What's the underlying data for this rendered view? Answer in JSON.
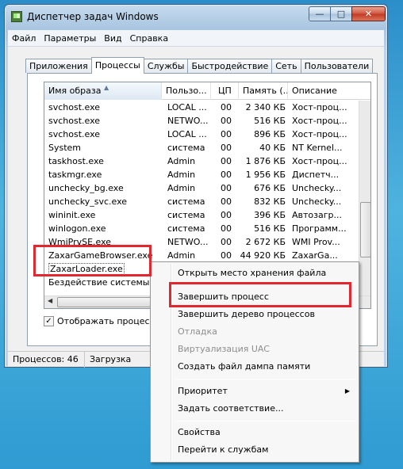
{
  "window": {
    "title": "Диспетчер задач Windows",
    "min_label": "—",
    "max_label": "□",
    "close_label": "✕"
  },
  "menu": [
    "Файл",
    "Параметры",
    "Вид",
    "Справка"
  ],
  "tabs": [
    "Приложения",
    "Процессы",
    "Службы",
    "Быстродействие",
    "Сеть",
    "Пользователи"
  ],
  "active_tab": "Процессы",
  "columns": [
    "Имя образа",
    "Пользо...",
    "ЦП",
    "Память (...",
    "Описание"
  ],
  "rows": [
    {
      "name": "svchost.exe",
      "user": "LOCAL ...",
      "cpu": "00",
      "mem": "2 340 КБ",
      "desc": "Хост-проц..."
    },
    {
      "name": "svchost.exe",
      "user": "NETWO...",
      "cpu": "00",
      "mem": "516 КБ",
      "desc": "Хост-проц..."
    },
    {
      "name": "svchost.exe",
      "user": "LOCAL ...",
      "cpu": "00",
      "mem": "896 КБ",
      "desc": "Хост-проц..."
    },
    {
      "name": "System",
      "user": "система",
      "cpu": "00",
      "mem": "40 КБ",
      "desc": "NT Kernel..."
    },
    {
      "name": "taskhost.exe",
      "user": "Admin",
      "cpu": "00",
      "mem": "1 876 КБ",
      "desc": "Хост-проц..."
    },
    {
      "name": "taskmgr.exe",
      "user": "Admin",
      "cpu": "00",
      "mem": "1 956 КБ",
      "desc": "Диспетч..."
    },
    {
      "name": "unchecky_bg.exe",
      "user": "Admin",
      "cpu": "00",
      "mem": "676 КБ",
      "desc": "Unchecky..."
    },
    {
      "name": "unchecky_svc.exe",
      "user": "система",
      "cpu": "00",
      "mem": "832 КБ",
      "desc": "Unchecky..."
    },
    {
      "name": "wininit.exe",
      "user": "система",
      "cpu": "00",
      "mem": "396 КБ",
      "desc": "Автозагр..."
    },
    {
      "name": "winlogon.exe",
      "user": "система",
      "cpu": "00",
      "mem": "516 КБ",
      "desc": "Программ..."
    },
    {
      "name": "WmiPrvSE.exe",
      "user": "NETWO...",
      "cpu": "00",
      "mem": "2 672 КБ",
      "desc": "WMI Prov..."
    },
    {
      "name": "ZaxarGameBrowser.exe",
      "user": "Admin",
      "cpu": "00",
      "mem": "44 920 КБ",
      "desc": "ZaxarGa..."
    },
    {
      "name": "ZaxarLoader.exe",
      "user": "",
      "cpu": "",
      "mem": "",
      "desc": ""
    },
    {
      "name": "Бездействие системы",
      "user": "",
      "cpu": "",
      "mem": "",
      "desc": ""
    }
  ],
  "show_all_label": "Отображать процессы в",
  "status": {
    "processes": "Процессов: 46",
    "cpu_load": "Загрузка"
  },
  "context_menu": {
    "open_location": "Открыть место хранения файла",
    "end_process": "Завершить процесс",
    "end_tree": "Завершить дерево процессов",
    "debug": "Отладка",
    "uac": "Виртуализация UAC",
    "dump": "Создать файл дампа памяти",
    "priority": "Приоритет",
    "affinity": "Задать соответствие...",
    "properties": "Свойства",
    "goto_services": "Перейти к службам"
  },
  "colors": {
    "highlight": "#e3262f"
  }
}
